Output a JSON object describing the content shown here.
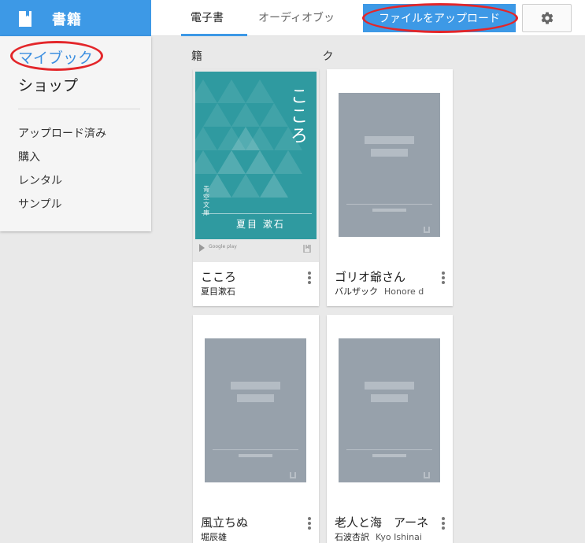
{
  "app": {
    "title": "書籍"
  },
  "sidebar": {
    "main": [
      "マイブック",
      "ショップ"
    ],
    "sub": [
      "アップロード済み",
      "購入",
      "レンタル",
      "サンプル"
    ]
  },
  "tabs": [
    {
      "label": "電子書",
      "active": true
    },
    {
      "label": "オーディオブッ",
      "active": false
    }
  ],
  "toolbar": {
    "upload_label": "ファイルをアップロード",
    "settings_icon": "gear-icon"
  },
  "section": {
    "label": "籍 ク"
  },
  "books": [
    {
      "title": "こころ",
      "author": "夏目漱石",
      "author_en": "",
      "cover": {
        "title": "こころ",
        "author": "夏目 漱石",
        "publisher": "青空文庫",
        "brand": "Google play"
      }
    },
    {
      "title": "ゴリオ爺さん",
      "author": "バルザック",
      "author_en": "Honore d"
    },
    {
      "title": "風立ちぬ",
      "author": "堀辰雄",
      "author_en": ""
    },
    {
      "title": "老人と海　アーネ",
      "author": "石波杏訳",
      "author_en": "Kyo Ishinai"
    }
  ],
  "colors": {
    "accent": "#3d99e6",
    "annotation": "#e3262a",
    "kokoro_cover": "#2f9aa0"
  }
}
